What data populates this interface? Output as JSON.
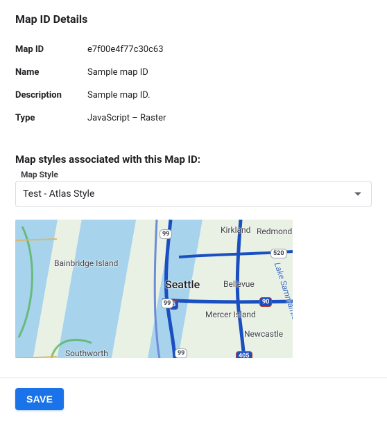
{
  "section_title": "Map ID Details",
  "details": {
    "rows": [
      {
        "label": "Map ID",
        "value": "e7f00e4f77c30c63"
      },
      {
        "label": "Name",
        "value": "Sample map ID"
      },
      {
        "label": "Description",
        "value": "Sample map ID."
      },
      {
        "label": "Type",
        "value": "JavaScript – Raster"
      }
    ]
  },
  "assoc_title": "Map styles associated with this Map ID:",
  "map_style": {
    "field_label": "Map Style",
    "selected": "Test - Atlas Style"
  },
  "map_preview": {
    "labels": {
      "seattle": "Seattle",
      "bellevue": "Bellevue",
      "kirkland": "Kirkland",
      "redmond": "Redmond",
      "bainbridge": "Bainbridge Island",
      "mercer": "Mercer Island",
      "newcastle": "Newcastle",
      "southworth": "Southworth",
      "sammamish": "Lake Sammamish"
    },
    "shields": {
      "i5": "5",
      "i90": "90",
      "i405": "405",
      "sr99a": "99",
      "sr99b": "99",
      "sr99c": "99",
      "sr520": "520"
    }
  },
  "footer": {
    "save_label": "SAVE"
  }
}
